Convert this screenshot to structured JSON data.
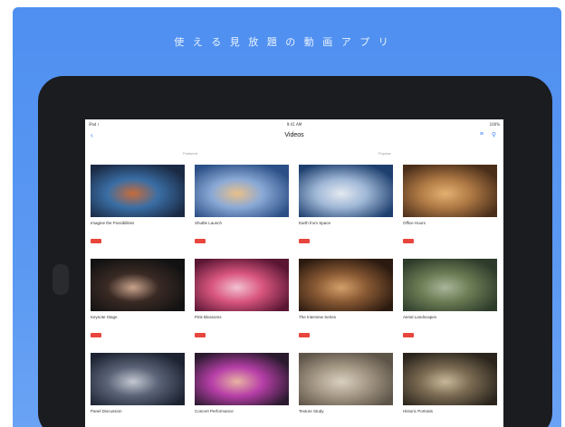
{
  "promo": {
    "headline": "使 え る 見 放 題 の 動 画 ア プ リ"
  },
  "status_bar": {
    "carrier": "iPad ⌇",
    "time": "9:41 AM",
    "battery": "100%"
  },
  "nav": {
    "back_label": "‹",
    "title": "Videos",
    "filter_label": "≡",
    "search_label": "⚲"
  },
  "segments": {
    "left": "Featured",
    "right": "Popular"
  },
  "videos": [
    {
      "title": "Imagine the Possibilities",
      "badge": "HD",
      "meta": "",
      "palette": [
        "#1b2a44",
        "#3a6ea5",
        "#c76b3a"
      ]
    },
    {
      "title": "Shuttle Launch",
      "badge": "HD",
      "meta": "",
      "palette": [
        "#2b4f86",
        "#8aa9d6",
        "#e9c08a"
      ]
    },
    {
      "title": "Earth from Space",
      "badge": "HD",
      "meta": "",
      "palette": [
        "#1d3f6e",
        "#9fb7d6",
        "#e4e9f1"
      ]
    },
    {
      "title": "Office Hours",
      "badge": "HD",
      "meta": "",
      "palette": [
        "#4a2e1a",
        "#b07a45",
        "#e3b071"
      ]
    },
    {
      "title": "Keynote Stage",
      "badge": "HD",
      "meta": "",
      "palette": [
        "#121212",
        "#3a2a24",
        "#c9a38c"
      ]
    },
    {
      "title": "Pink Blossoms",
      "badge": "HD",
      "meta": "",
      "palette": [
        "#5a1633",
        "#d9567f",
        "#f2c1d2"
      ]
    },
    {
      "title": "The Interview Series",
      "badge": "HD",
      "meta": "",
      "palette": [
        "#2b1a10",
        "#8a5a34",
        "#d3a06a"
      ]
    },
    {
      "title": "Aerial Landscapes",
      "badge": "HD",
      "meta": "",
      "palette": [
        "#2d3b2a",
        "#6c7d55",
        "#a9b59a"
      ]
    },
    {
      "title": "Panel Discussion",
      "badge": "",
      "meta": "",
      "palette": [
        "#1c2230",
        "#5b6478",
        "#c3c8d1"
      ]
    },
    {
      "title": "Concert Performance",
      "badge": "",
      "meta": "",
      "palette": [
        "#2a1a2e",
        "#b73fa8",
        "#e8b3a2"
      ]
    },
    {
      "title": "Texture Study",
      "badge": "",
      "meta": "",
      "palette": [
        "#5e5549",
        "#a89b88",
        "#d9d0c1"
      ]
    },
    {
      "title": "Historic Portraits",
      "badge": "",
      "meta": "",
      "palette": [
        "#2a241c",
        "#7a6a52",
        "#c8b899"
      ]
    }
  ]
}
